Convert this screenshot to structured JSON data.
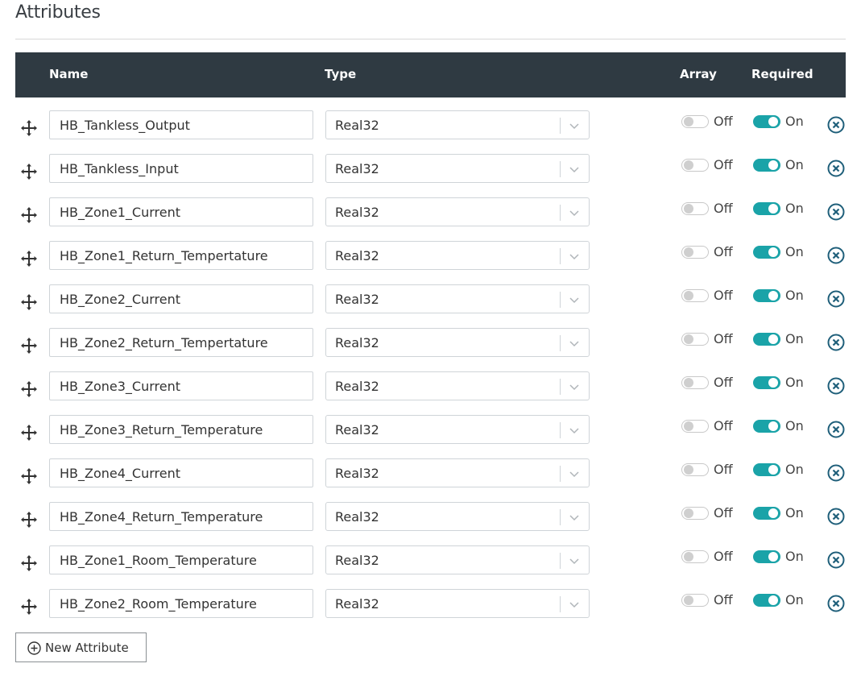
{
  "page": {
    "title": "Attributes"
  },
  "table": {
    "headers": {
      "name": "Name",
      "type": "Type",
      "array": "Array",
      "required": "Required"
    },
    "rows": [
      {
        "name": "HB_Tankless_Output",
        "type": "Real32",
        "array": "Off",
        "required": "On"
      },
      {
        "name": "HB_Tankless_Input",
        "type": "Real32",
        "array": "Off",
        "required": "On"
      },
      {
        "name": "HB_Zone1_Current",
        "type": "Real32",
        "array": "Off",
        "required": "On"
      },
      {
        "name": "HB_Zone1_Return_Tempertature",
        "type": "Real32",
        "array": "Off",
        "required": "On"
      },
      {
        "name": "HB_Zone2_Current",
        "type": "Real32",
        "array": "Off",
        "required": "On"
      },
      {
        "name": "HB_Zone2_Return_Tempertature",
        "type": "Real32",
        "array": "Off",
        "required": "On"
      },
      {
        "name": "HB_Zone3_Current",
        "type": "Real32",
        "array": "Off",
        "required": "On"
      },
      {
        "name": "HB_Zone3_Return_Temperature",
        "type": "Real32",
        "array": "Off",
        "required": "On"
      },
      {
        "name": "HB_Zone4_Current",
        "type": "Real32",
        "array": "Off",
        "required": "On"
      },
      {
        "name": "HB_Zone4_Return_Temperature",
        "type": "Real32",
        "array": "Off",
        "required": "On"
      },
      {
        "name": "HB_Zone1_Room_Temperature",
        "type": "Real32",
        "array": "Off",
        "required": "On"
      },
      {
        "name": "HB_Zone2_Room_Temperature",
        "type": "Real32",
        "array": "Off",
        "required": "On"
      }
    ]
  },
  "new_attribute_label": "New Attribute",
  "icons": {
    "drag": "move-icon",
    "chevron": "chevron-down-icon",
    "remove": "close-circle-icon",
    "add": "plus-circle-icon"
  },
  "colors": {
    "header_bg": "#2f3a42",
    "toggle_on": "#1aa3a8",
    "remove_icon": "#1f5f7a"
  }
}
